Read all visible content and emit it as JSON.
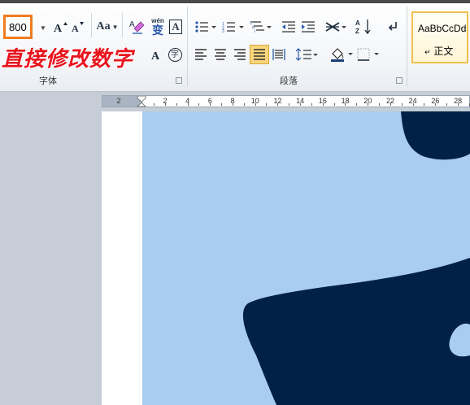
{
  "font_group": {
    "label": "字体",
    "font_size": "800",
    "grow_font_icon": "font-grow-icon",
    "shrink_font_icon": "font-shrink-icon",
    "change_case_label": "Aa",
    "pinyin_label": "wén",
    "pinyin_char": "变",
    "border_char_label": "A",
    "enclose_char_label": "字"
  },
  "paragraph_group": {
    "label": "段落"
  },
  "styles_group": {
    "sample_text": "AaBbCcDd",
    "style_name": "正文",
    "style_mark": "↵"
  },
  "annotation": {
    "text": "直接修改数字",
    "color": "#e8141d"
  },
  "ruler": {
    "labels": [
      "2",
      "2",
      "4",
      "6",
      "8",
      "10",
      "12",
      "14",
      "16",
      "18",
      "20",
      "22",
      "24",
      "26",
      "28"
    ]
  },
  "colors": {
    "highlight_orange": "#f07c1e",
    "canvas_light_blue": "#a9cdf0",
    "shape_dark_navy": "#012147",
    "active_button": "#f9d57b"
  }
}
